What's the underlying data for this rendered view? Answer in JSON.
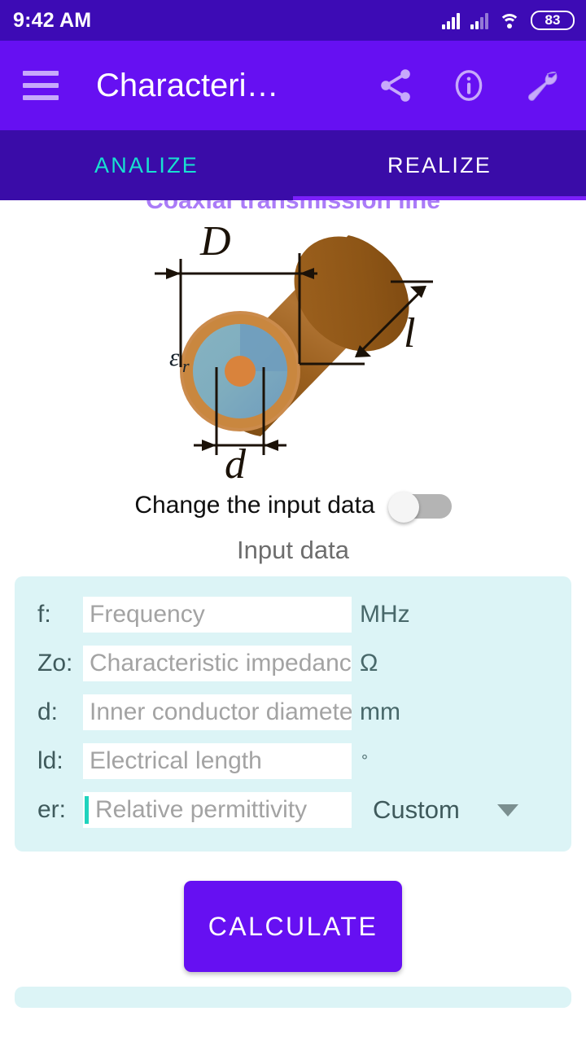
{
  "statusbar": {
    "time": "9:42 AM",
    "battery_level": "83",
    "icons": [
      "signal-icon",
      "signal-icon",
      "wifi-icon",
      "battery-icon"
    ]
  },
  "appbar": {
    "menu_icon": "hamburger-menu-icon",
    "title": "Characteri…",
    "actions": [
      {
        "name": "share-icon",
        "label": "Share"
      },
      {
        "name": "info-icon",
        "label": "Info"
      },
      {
        "name": "wrench-icon",
        "label": "Settings"
      }
    ],
    "background": "#6610F2"
  },
  "tabs": {
    "items": [
      {
        "label": "ANALIZE",
        "active": true
      },
      {
        "label": "REALIZE",
        "active": false
      }
    ],
    "active_color": "#18E0D0",
    "inactive_color": "#FFFFFF",
    "background": "#3A0CA8"
  },
  "scrolled_text": "Coaxial transmission line",
  "diagram": {
    "name": "coaxial-cable-diagram",
    "labels": {
      "outer_diameter": "D",
      "inner_diameter": "d",
      "length": "l",
      "permittivity": "εr"
    },
    "colors": {
      "outer_conductor": "#8B5A18",
      "outer_conductor_light": "#A9692A",
      "jacket_ring": "#CE8A47",
      "dielectric": "#7FAFC0",
      "dielectric_shade": "#6E9CBF",
      "inner_conductor": "#D9833C"
    }
  },
  "toggle": {
    "label": "Change the input data",
    "checked": false
  },
  "input_section": {
    "title": "Input data",
    "card_background": "#DCF4F6",
    "fields": [
      {
        "label": "f:",
        "placeholder": "Frequency",
        "value": "",
        "unit": "MHz",
        "focused": false,
        "name": "frequency-field"
      },
      {
        "label": "Zo:",
        "placeholder": "Characteristic impedance",
        "value": "",
        "unit": "Ω",
        "focused": false,
        "name": "impedance-field"
      },
      {
        "label": "d:",
        "placeholder": "Inner conductor diameter",
        "value": "",
        "unit": "mm",
        "focused": false,
        "name": "inner-diameter-field"
      },
      {
        "label": "ld:",
        "placeholder": "Electrical length",
        "value": "",
        "unit": "°",
        "focused": false,
        "name": "electrical-length-field"
      },
      {
        "label": "er:",
        "placeholder": "Relative permittivity",
        "value": "",
        "unit": "",
        "focused": true,
        "name": "permittivity-field"
      }
    ],
    "material_dropdown": {
      "selected": "Custom",
      "arrow_icon": "chevron-down-icon"
    }
  },
  "calculate_button": {
    "label": "CALCULATE",
    "color": "#6610F2"
  }
}
